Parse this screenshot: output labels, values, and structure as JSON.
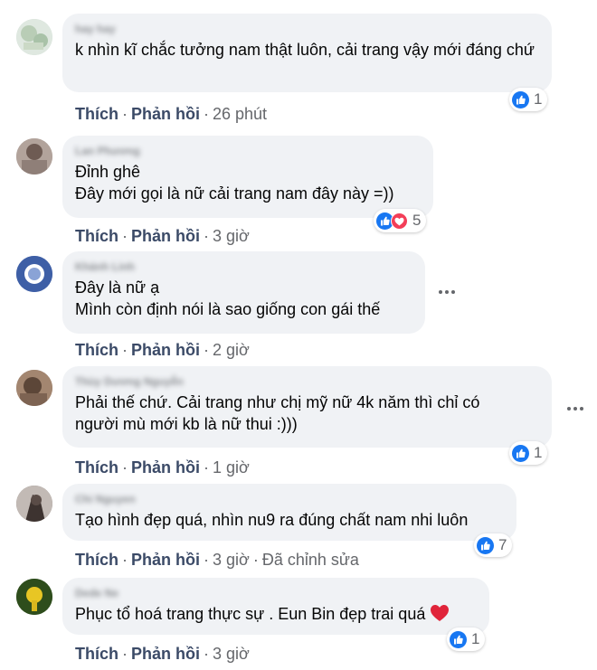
{
  "labels": {
    "like": "Thích",
    "reply": "Phản hồi",
    "sep": "·"
  },
  "comments": [
    {
      "author": "hay hay",
      "lines": "k nhìn kĩ chắc tưởng nam thật luôn, cải trang vậy mới đáng chứ",
      "time": "26 phút",
      "reaction_count": "1"
    },
    {
      "author": "Lan Phương",
      "line1": "Đỉnh ghê",
      "line2": "Đây mới gọi là nữ cải trang nam đây này =))",
      "time": "3 giờ",
      "reaction_count": "5"
    },
    {
      "author": "Khánh Linh",
      "line1": "Đây là nữ ạ",
      "line2": "Mình còn định nói là sao giống con gái thế",
      "time": "2 giờ"
    },
    {
      "author": "Thùy Dương Nguyễn",
      "line1": "Phải thế chứ. Cải trang như chị mỹ nữ 4k năm thì chỉ có",
      "line2": "người mù mới kb là nữ thui :)))",
      "time": "1 giờ",
      "reaction_count": "1"
    },
    {
      "author": "Chi Nguyen",
      "line1": "Tạo hình đẹp quá, nhìn nu9 ra đúng chất nam nhi luôn",
      "time": "3 giờ",
      "edited": "Đã chỉnh sửa",
      "reaction_count": "7"
    },
    {
      "author": "Dede Ne",
      "line1": "Phục tổ hoá trang thực sự . Eun Bin đẹp trai quá",
      "time": "3 giờ",
      "reaction_count": "1"
    }
  ],
  "colors": {
    "bubble": "#f0f2f5",
    "like_blue": "#1877f2",
    "heart_red": "#f33e58",
    "action": "#3b4a67"
  }
}
